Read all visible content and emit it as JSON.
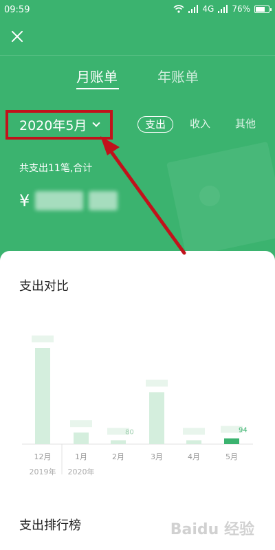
{
  "status_bar": {
    "time": "09:59",
    "network": "4G",
    "battery_text": "76%",
    "battery_level": 0.76
  },
  "tabs": [
    {
      "label": "月账单",
      "active": true
    },
    {
      "label": "年账单",
      "active": false
    }
  ],
  "month_selector": {
    "label": "2020年5月"
  },
  "filters": [
    {
      "label": "支出",
      "active": true
    },
    {
      "label": "收入",
      "active": false
    },
    {
      "label": "其他",
      "active": false
    }
  ],
  "summary": {
    "text": "共支出11笔,合计",
    "currency": "¥"
  },
  "compare_section": {
    "title": "支出对比"
  },
  "ranking_section": {
    "title": "支出排行榜"
  },
  "watermark": "Baidu 经验",
  "colors": {
    "primary": "#3bb36f",
    "highlight_red": "#c1121b",
    "bar_light": "#d4eedd",
    "bar_current": "#3bb36f"
  },
  "chart_data": {
    "type": "bar",
    "title": "支出对比",
    "categories": [
      "12月",
      "1月",
      "2月",
      "3月",
      "4月",
      "5月"
    ],
    "category_years": [
      "2019年",
      "2020年",
      "",
      "",
      "",
      ""
    ],
    "values": [
      100,
      12,
      4,
      54,
      4,
      6
    ],
    "value_labels": [
      "",
      "",
      "80",
      "",
      "",
      "94"
    ],
    "highlight_index": 5,
    "ylim": [
      0,
      100
    ],
    "grid": false,
    "legend": "none"
  }
}
